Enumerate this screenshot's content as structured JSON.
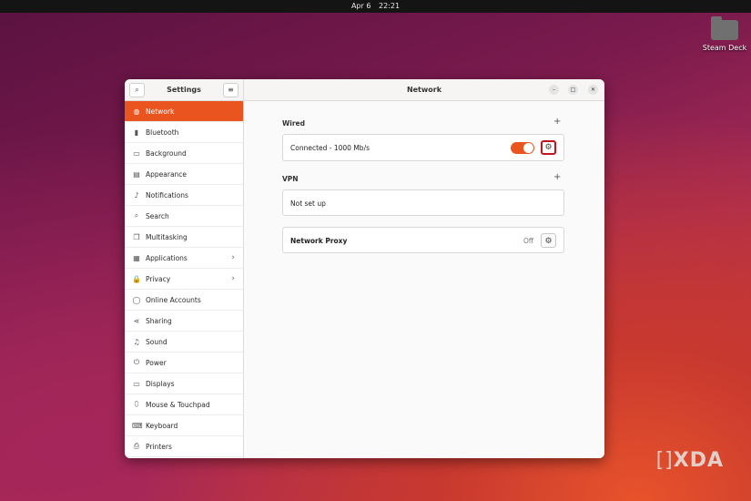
{
  "topbar": {
    "date": "Apr 6",
    "time": "22:21"
  },
  "desktop": {
    "icon_label": "Steam Deck",
    "watermark": "XDA",
    "watermark_bracket": "[]"
  },
  "settings": {
    "sidebar_title": "Settings",
    "search_icon": "⌕",
    "menu_icon": "≡",
    "items": [
      {
        "label": "Network",
        "icon": "◍",
        "active": true
      },
      {
        "label": "Bluetooth",
        "icon": "▮"
      },
      {
        "label": "Background",
        "icon": "▭"
      },
      {
        "label": "Appearance",
        "icon": "▤"
      },
      {
        "label": "Notifications",
        "icon": "♪"
      },
      {
        "label": "Search",
        "icon": "⌕"
      },
      {
        "label": "Multitasking",
        "icon": "❐"
      },
      {
        "label": "Applications",
        "icon": "▦",
        "chevron": "›"
      },
      {
        "label": "Privacy",
        "icon": "🔒",
        "chevron": "›"
      },
      {
        "label": "Online Accounts",
        "icon": "◯"
      },
      {
        "label": "Sharing",
        "icon": "⋖"
      },
      {
        "label": "Sound",
        "icon": "♫"
      },
      {
        "label": "Power",
        "icon": "⏻"
      },
      {
        "label": "Displays",
        "icon": "▭"
      },
      {
        "label": "Mouse & Touchpad",
        "icon": "⬯"
      },
      {
        "label": "Keyboard",
        "icon": "⌨"
      },
      {
        "label": "Printers",
        "icon": "⎙"
      }
    ]
  },
  "main": {
    "title": "Network",
    "window_controls": {
      "minimize": "–",
      "maximize": "□",
      "close": "✕"
    },
    "wired": {
      "label": "Wired",
      "add": "+",
      "status": "Connected - 1000 Mb/s",
      "toggle_on": true,
      "gear": "⚙"
    },
    "vpn": {
      "label": "VPN",
      "add": "+",
      "status": "Not set up"
    },
    "proxy": {
      "label": "Network Proxy",
      "state": "Off",
      "gear": "⚙"
    }
  },
  "colors": {
    "accent": "#e9541f",
    "highlight": "#c4141b"
  }
}
